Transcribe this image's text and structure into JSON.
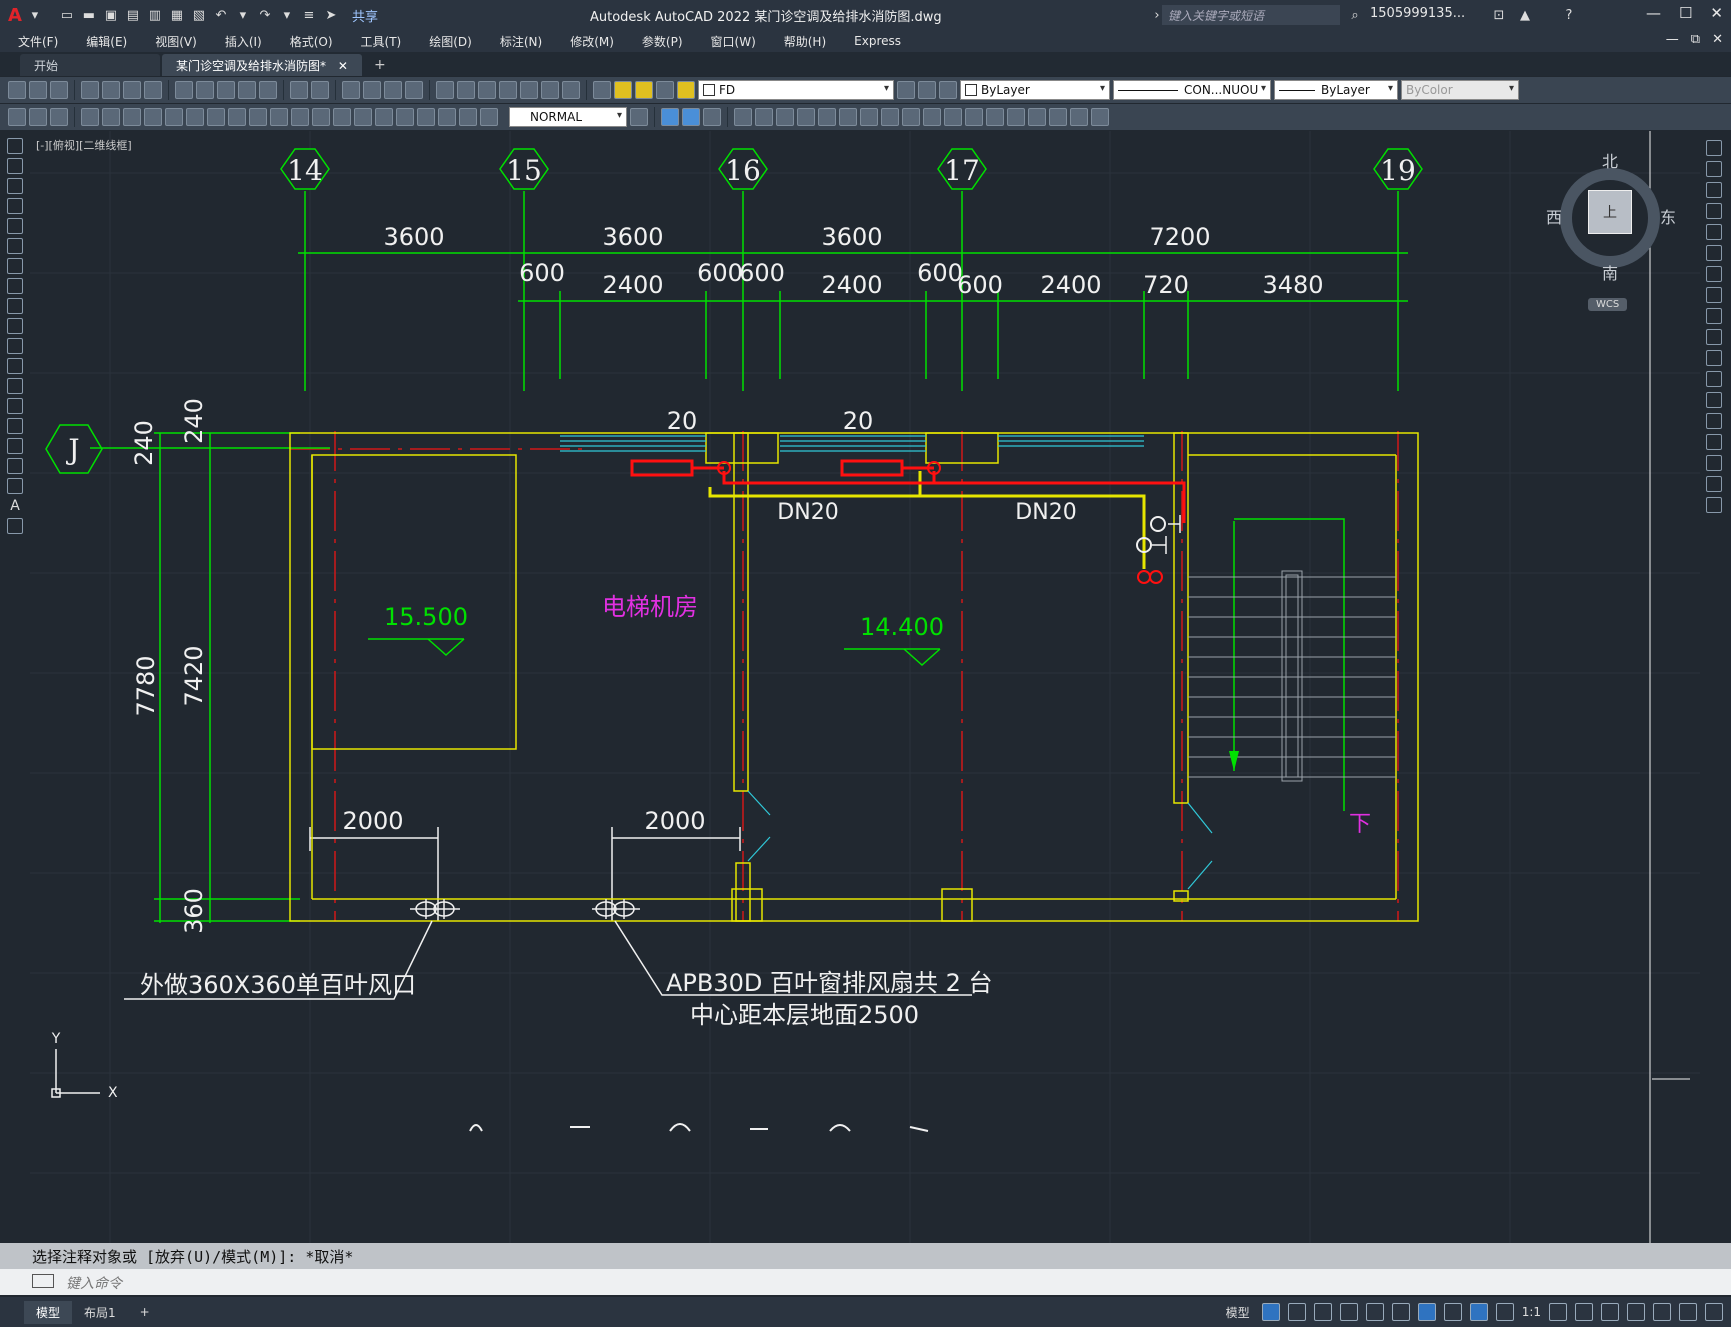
{
  "app": {
    "logo": "A",
    "title": "Autodesk AutoCAD 2022    某门诊空调及给排水消防图.dwg",
    "share_label": "共享",
    "search_placeholder": "键入关键字或短语",
    "user": "1505999135...",
    "window_buttons": [
      "—",
      "☐",
      "✕"
    ],
    "mdi_buttons": [
      "—",
      "⧉",
      "✕"
    ]
  },
  "menu": [
    "文件(F)",
    "编辑(E)",
    "视图(V)",
    "插入(I)",
    "格式(O)",
    "工具(T)",
    "绘图(D)",
    "标注(N)",
    "修改(M)",
    "参数(P)",
    "窗口(W)",
    "帮助(H)",
    "Express"
  ],
  "tabs": [
    {
      "label": "开始",
      "active": false
    },
    {
      "label": "某门诊空调及给排水消防图*",
      "active": true
    }
  ],
  "toolbar": {
    "layer_value": "FD",
    "color_value": "ByLayer",
    "linetype_value": "CON...NUOU",
    "lineweight_value": "ByLayer",
    "plotstyle_value": "ByColor",
    "dimstyle_value": "NORMAL"
  },
  "view_label": "[-][俯视][二维线框]",
  "viewcube": {
    "north": "北",
    "south": "南",
    "east": "东",
    "west": "西",
    "face": "上",
    "wcs": "WCS"
  },
  "drawing": {
    "grid_axes": [
      "14",
      "15",
      "16",
      "17",
      "19"
    ],
    "row_axis": "J",
    "dims_top_row1": [
      "3600",
      "3600",
      "3600",
      "7200"
    ],
    "dims_top_row2": [
      "600",
      "2400",
      "600",
      "600",
      "2400",
      "600",
      "600",
      "2400",
      "720",
      "3480"
    ],
    "dims_left": [
      "240",
      "240",
      "7780",
      "7420",
      "360"
    ],
    "dims_bottom": [
      "2000",
      "2000"
    ],
    "dims_20": [
      "20",
      "20"
    ],
    "pipe_labels": [
      "DN20",
      "DN20"
    ],
    "room_name": "电梯机房",
    "elevations": [
      "15.500",
      "14.400"
    ],
    "stair_label": "下",
    "note1": "外做360X360单百叶风口",
    "note2_line1": "APB30D 百叶窗排风扇共 2 台",
    "note2_line2": "中心距本层地面2500",
    "ucs_y": "Y",
    "ucs_x": "X"
  },
  "command": {
    "history": "选择注释对象或 [放弃(U)/模式(M)]: *取消*",
    "placeholder": "键入命令"
  },
  "status": {
    "layout_tabs": [
      {
        "label": "模型",
        "active": true
      },
      {
        "label": "布局1",
        "active": false
      }
    ],
    "model_label": "模型",
    "scale": "1:1"
  },
  "colors": {
    "background": "#212830",
    "grid_green": "#00e000",
    "wall_yellow": "#e6e600",
    "pipe_red": "#ff1010",
    "axis_red": "#d01818",
    "cyan": "#30c8d8",
    "magenta": "#e030e0",
    "white": "#f0f0f0"
  }
}
